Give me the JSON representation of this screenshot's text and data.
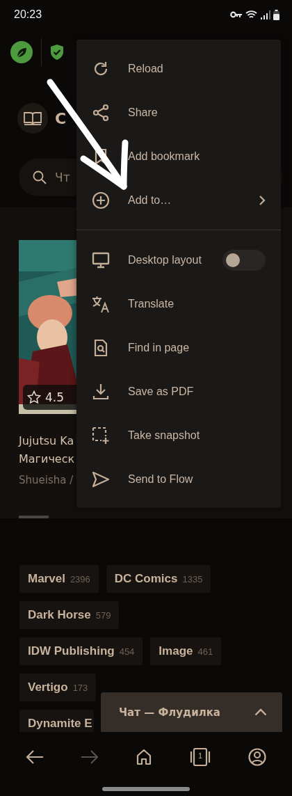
{
  "status_bar": {
    "time": "20:23"
  },
  "header": {
    "title": "C"
  },
  "search": {
    "placeholder": "Чт"
  },
  "featured": {
    "rating": "4.5",
    "title_lines": [
      "Jujutsu Ka",
      "Магическ"
    ],
    "publisher": "Shueisha /"
  },
  "tag_rows": [
    [
      {
        "name": "Marvel",
        "count": "2396"
      },
      {
        "name": "DC Comics",
        "count": "1335"
      }
    ],
    [
      {
        "name": "Dark Horse",
        "count": "579"
      }
    ],
    [
      {
        "name": "IDW Publishing",
        "count": "454"
      },
      {
        "name": "Image",
        "count": "461"
      }
    ],
    [
      {
        "name": "Vertigo",
        "count": "173"
      }
    ],
    [
      {
        "name": "Dynamite E"
      }
    ]
  ],
  "chat": {
    "title": "Чат — Флудилка"
  },
  "menu": {
    "groups": [
      [
        {
          "kind": "item",
          "label": "Reload"
        },
        {
          "kind": "item",
          "label": "Share"
        },
        {
          "kind": "item",
          "label": "Add bookmark"
        },
        {
          "kind": "submenu",
          "label": "Add to…"
        }
      ],
      [
        {
          "kind": "toggle",
          "label": "Desktop layout",
          "on": false
        },
        {
          "kind": "item",
          "label": "Translate"
        },
        {
          "kind": "item",
          "label": "Find in page"
        },
        {
          "kind": "item",
          "label": "Save as PDF"
        },
        {
          "kind": "item",
          "label": "Take snapshot"
        },
        {
          "kind": "item",
          "label": "Send to Flow"
        }
      ]
    ]
  },
  "nav": [
    {
      "disabled": false
    },
    {
      "disabled": true
    },
    {
      "disabled": false
    },
    {
      "count": "1",
      "disabled": false
    },
    {
      "disabled": false
    }
  ]
}
